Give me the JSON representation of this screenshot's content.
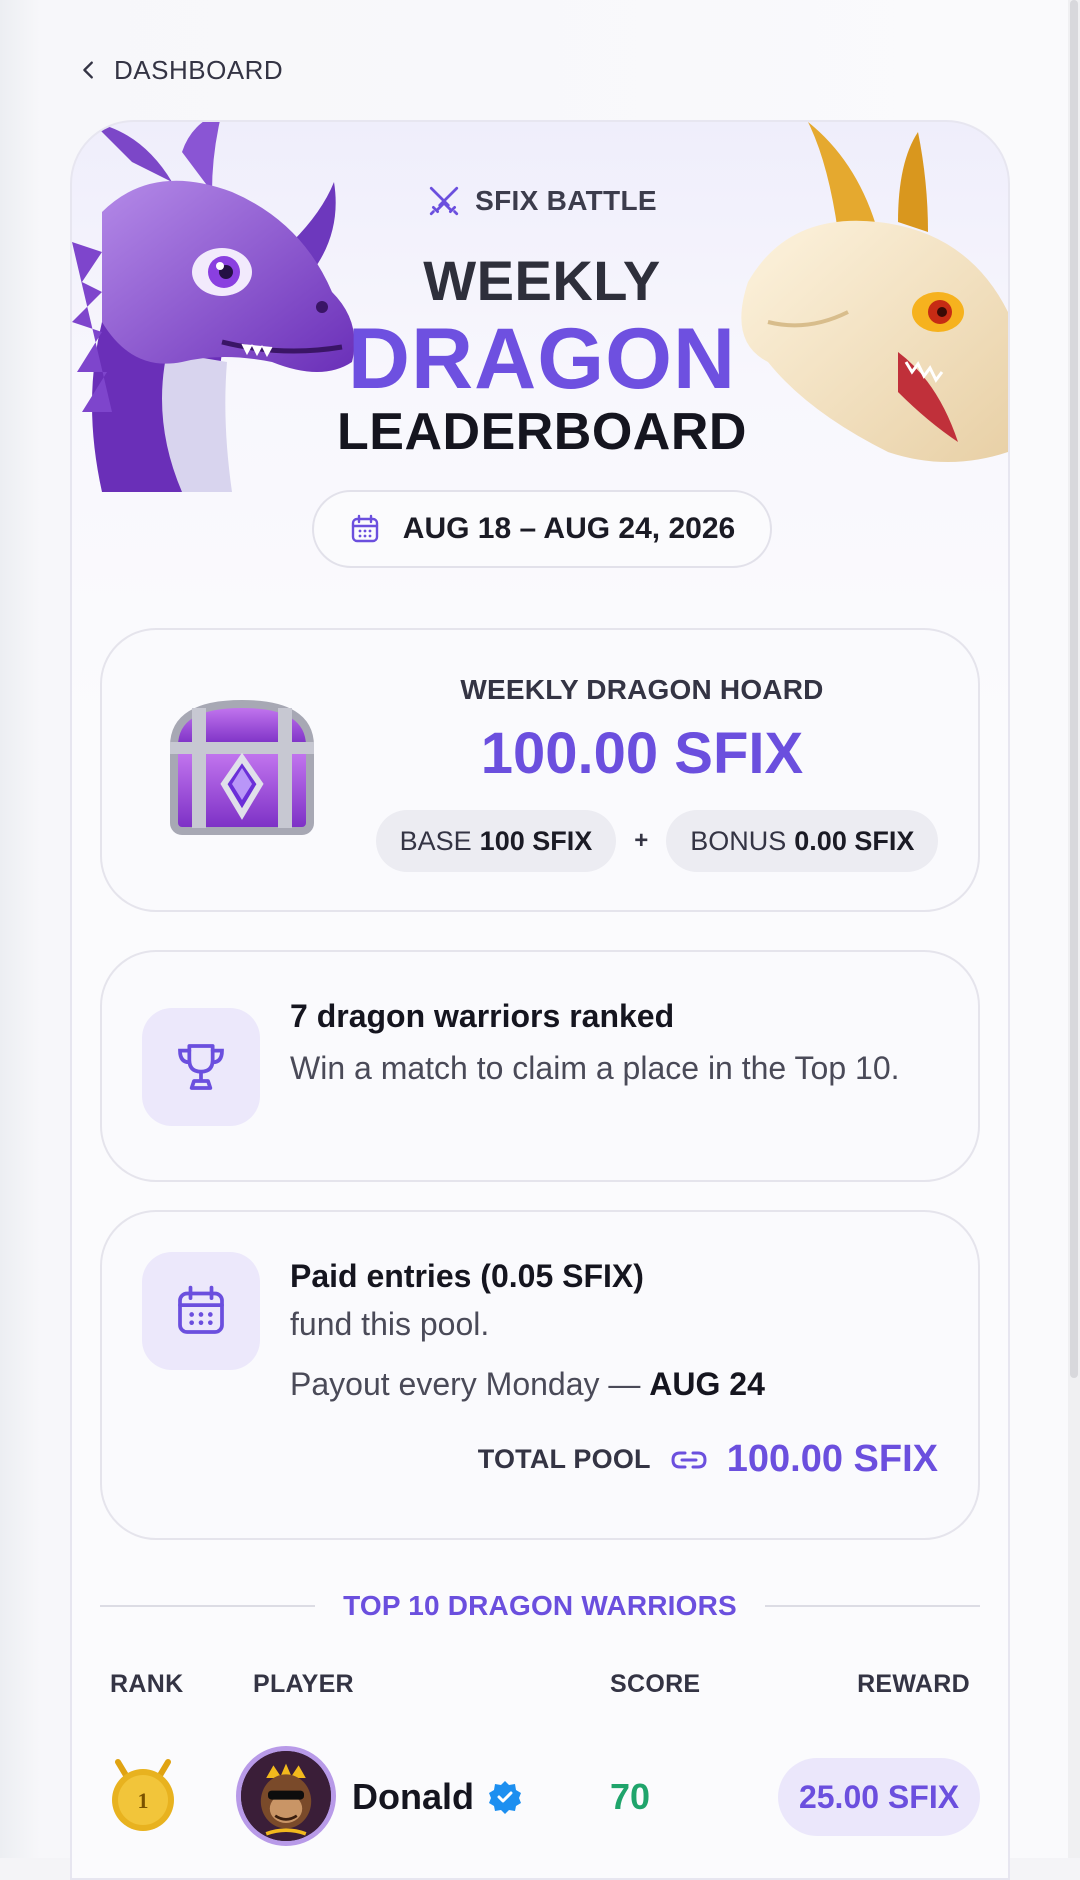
{
  "nav": {
    "back_label": "DASHBOARD"
  },
  "hero": {
    "badge": "SFIX BATTLE",
    "title_line1": "WEEKLY",
    "title_line2": "DRAGON",
    "title_line3": "LEADERBOARD",
    "date_range": "AUG 18 – AUG 24, 2026"
  },
  "hoard": {
    "label": "WEEKLY DRAGON HOARD",
    "amount": "100.00 SFIX",
    "base_label": "BASE",
    "base_value": "100 SFIX",
    "plus": "+",
    "bonus_label": "BONUS",
    "bonus_value": "0.00 SFIX"
  },
  "warriors": {
    "title": "7 dragon warriors ranked",
    "description": "Win a match to claim a place in the Top 10."
  },
  "entries": {
    "title": "Paid entries (0.05 SFIX)",
    "line2": "fund this pool.",
    "payout_prefix": "Payout every Monday —",
    "payout_date": "AUG 24",
    "total_label": "TOTAL POOL",
    "total_amount": "100.00 SFIX"
  },
  "leaderboard": {
    "section_title": "TOP 10 DRAGON WARRIORS",
    "columns": {
      "rank": "RANK",
      "player": "PLAYER",
      "score": "SCORE",
      "reward": "REWARD"
    },
    "rows": [
      {
        "rank": "1",
        "player": "Donald",
        "verified": true,
        "score": "70",
        "reward": "25.00 SFIX"
      }
    ]
  },
  "colors": {
    "accent": "#6b4fde",
    "score_green": "#1fa46b",
    "gold": "#e8b21f"
  },
  "icons": {
    "back": "chevron-left-icon",
    "battle": "crossed-swords-icon",
    "calendar": "calendar-icon",
    "trophy": "trophy-icon",
    "link": "link-icon",
    "verified": "verified-badge-icon"
  }
}
